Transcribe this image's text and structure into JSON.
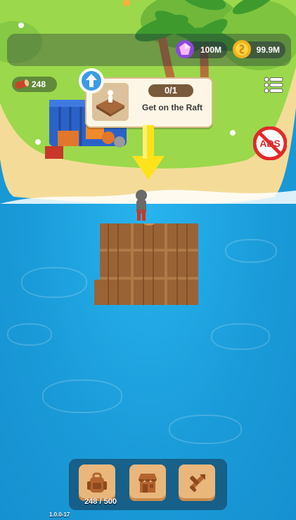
{
  "resources": {
    "gems": "100M",
    "coins": "99.9M",
    "wood": "248"
  },
  "quest": {
    "progress": "0/1",
    "title": "Get on the Raft"
  },
  "noads_label": "ADS",
  "inventory": {
    "capacity": "248 / 500"
  },
  "version": "1.0.0-17",
  "icons": {
    "gem": "gem-icon",
    "coin": "coin-icon",
    "wood": "wood-log-icon",
    "menu": "list-menu-icon",
    "noads": "no-ads-icon",
    "up": "up-arrow-icon",
    "backpack": "backpack-icon",
    "shop": "shop-icon",
    "craft": "crafting-icon"
  },
  "colors": {
    "sea": "#1ea3de",
    "sand": "#f4dc98",
    "grass": "#9bd84c",
    "accent_arrow": "#ffe21a"
  }
}
